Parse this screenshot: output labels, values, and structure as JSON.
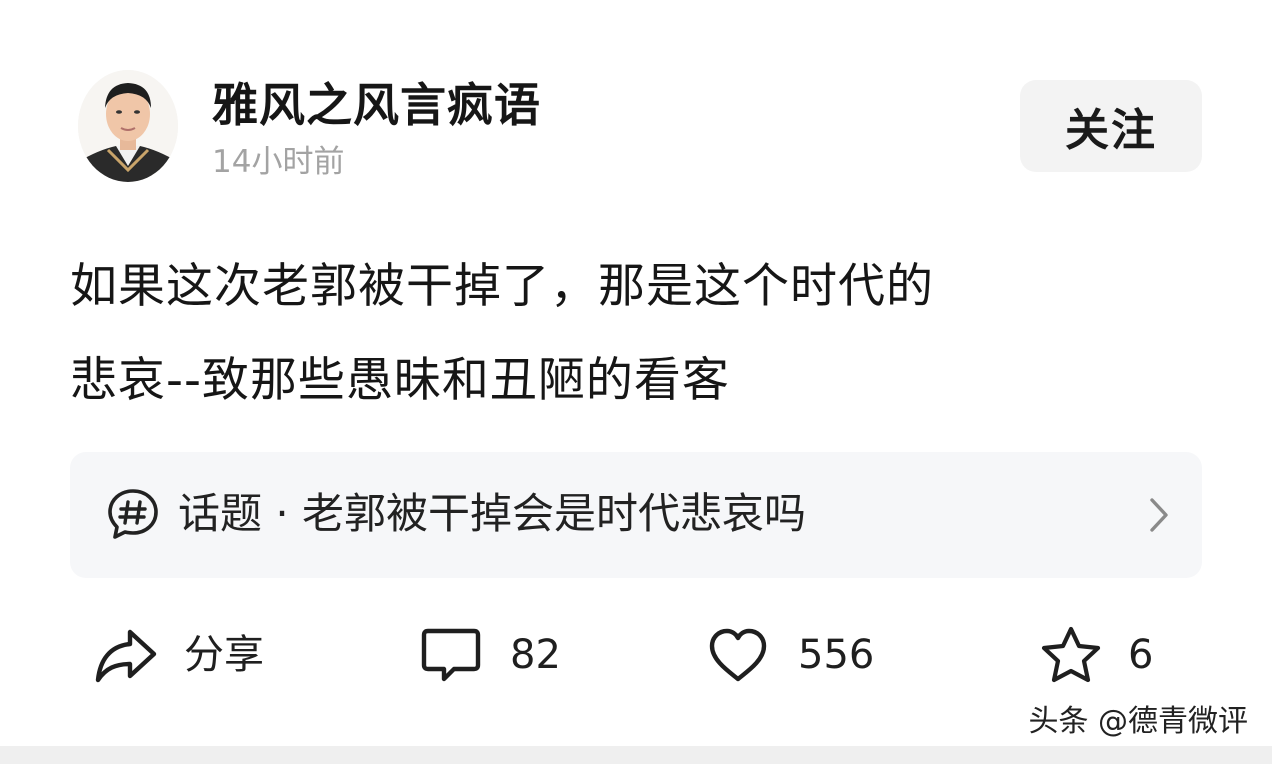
{
  "author": {
    "name": "雅风之风言疯语",
    "time": "14小时前",
    "follow_label": "关注"
  },
  "post": {
    "line1": "如果这次老郭被干掉了，那是这个时代的",
    "line2": "悲哀--致那些愚昧和丑陋的看客"
  },
  "topic": {
    "label": "话题 · 老郭被干掉会是时代悲哀吗"
  },
  "actions": {
    "share_label": "分享",
    "comment_count": "82",
    "like_count": "556",
    "favorite_count": "6"
  },
  "watermark": "头条 @德青微评",
  "colors": {
    "follow_bg": "#f3f3f3",
    "topic_bg": "#f6f7f9",
    "muted_text": "#a3a3a3"
  },
  "icons": [
    "share-icon",
    "comment-icon",
    "like-icon",
    "favorite-icon",
    "hashtag-icon",
    "chevron-right-icon"
  ]
}
